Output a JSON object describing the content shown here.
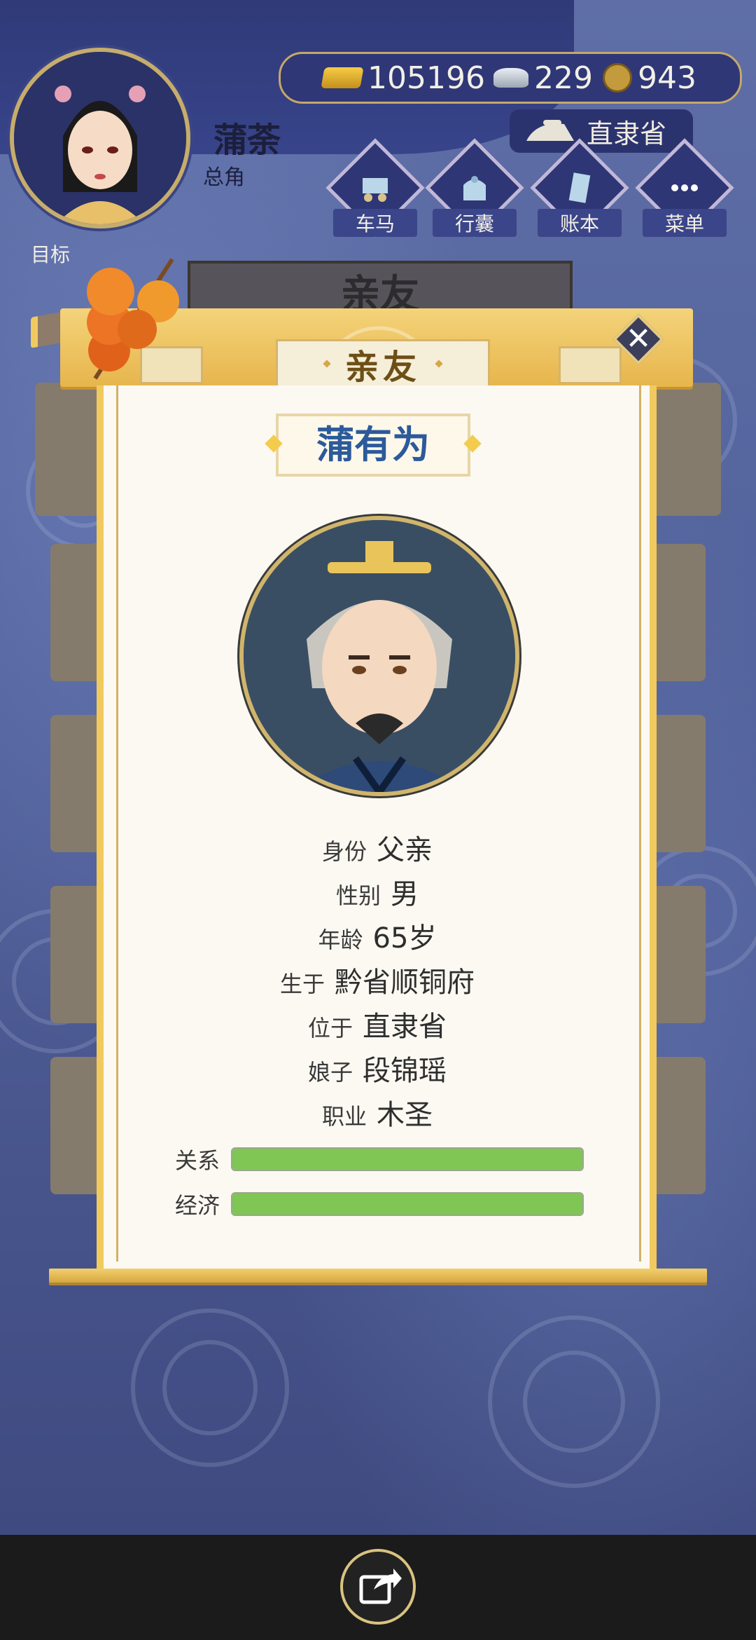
{
  "player": {
    "name": "蒲荼",
    "role": "总角"
  },
  "currency": {
    "gold": "105196",
    "silver": "229",
    "coins": "943"
  },
  "location": {
    "label": "直隶省"
  },
  "menu": [
    {
      "label": "车马",
      "icon": "carriage-icon"
    },
    {
      "label": "行囊",
      "icon": "bag-icon"
    },
    {
      "label": "账本",
      "icon": "ledger-icon"
    },
    {
      "label": "菜单",
      "icon": "more-icon"
    }
  ],
  "target_label": "目标",
  "background_title": "亲友",
  "panel": {
    "title": "亲友",
    "person_name": "蒲有为",
    "info": [
      {
        "key": "身份",
        "value": "父亲"
      },
      {
        "key": "性别",
        "value": "男"
      },
      {
        "key": "年龄",
        "value": "65岁"
      },
      {
        "key": "生于",
        "value": "黔省顺铜府"
      },
      {
        "key": "位于",
        "value": "直隶省"
      },
      {
        "key": "娘子",
        "value": "段锦瑶"
      },
      {
        "key": "职业",
        "value": "木圣"
      }
    ],
    "bars": [
      {
        "label": "关系",
        "fill": 1.0
      },
      {
        "label": "经济",
        "fill": 1.0
      }
    ]
  },
  "colors": {
    "bar_fill": "#7fc654",
    "accent_gold": "#f1ca5f",
    "name_blue": "#2c5a9a"
  }
}
